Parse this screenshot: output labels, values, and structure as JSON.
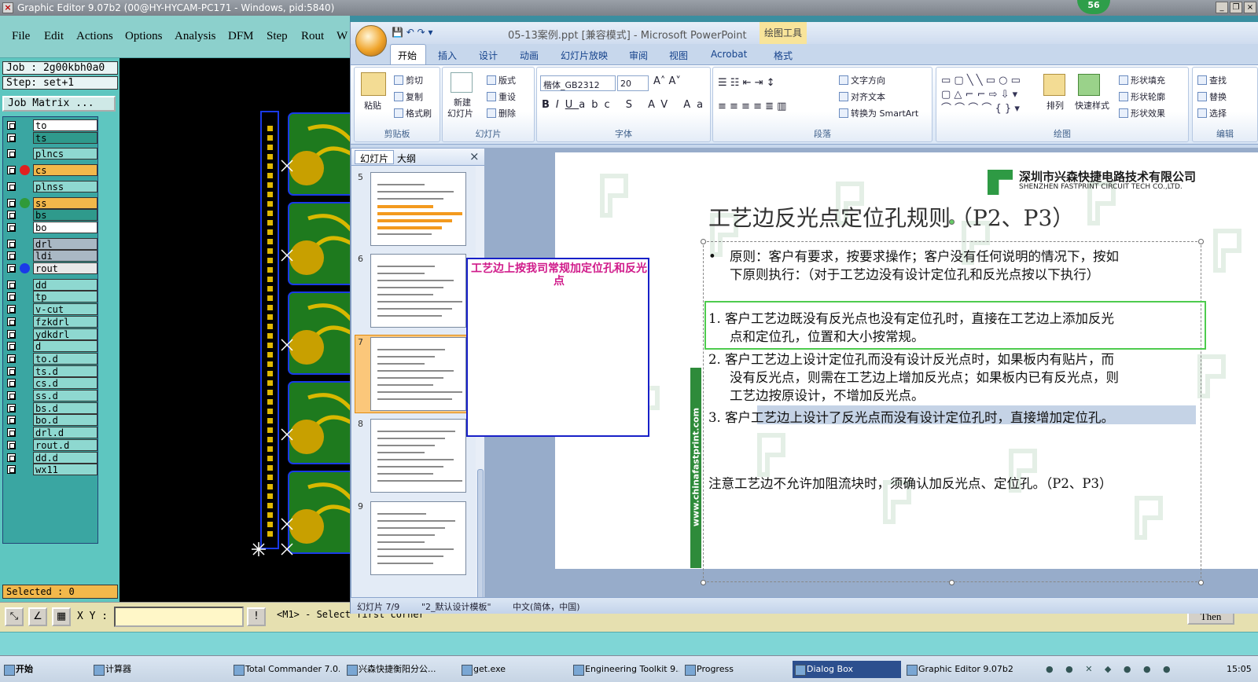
{
  "ge": {
    "title": "Graphic Editor 9.07b2 (00@HY-HYCAM-PC171 - Windows, pid:5840)",
    "menu": [
      "File",
      "Edit",
      "Actions",
      "Options",
      "Analysis",
      "DFM",
      "Step",
      "Rout",
      "W"
    ],
    "job": "Job : 2g00kbh0a0",
    "step": "Step: set+1",
    "job_matrix": "Job Matrix ...",
    "layers": [
      {
        "name": "to",
        "color": "#ffffff",
        "dot": ""
      },
      {
        "name": "ts",
        "color": "#2f9a8c",
        "dot": ""
      },
      {
        "name": "plncs",
        "color": "#8ed8d0",
        "dot": ""
      },
      {
        "name": "cs",
        "color": "#f2b84b",
        "dot": "#e02020"
      },
      {
        "name": "plnss",
        "color": "#8ed8d0",
        "dot": ""
      },
      {
        "name": "ss",
        "color": "#f2b84b",
        "dot": "#2f9a3a"
      },
      {
        "name": "bs",
        "color": "#2f9a8c",
        "dot": ""
      },
      {
        "name": "bo",
        "color": "#ffffff",
        "dot": ""
      },
      {
        "name": "drl",
        "color": "#a9b8c4",
        "dot": ""
      },
      {
        "name": "ldi",
        "color": "#a9b8c4",
        "dot": ""
      },
      {
        "name": "rout",
        "color": "#e8e8e8",
        "dot": "#1a3ae8"
      },
      {
        "name": "dd",
        "color": "#8ed8d0",
        "dot": ""
      },
      {
        "name": "tp",
        "color": "#8ed8d0",
        "dot": ""
      },
      {
        "name": "v-cut",
        "color": "#8ed8d0",
        "dot": ""
      },
      {
        "name": "fzkdrl",
        "color": "#8ed8d0",
        "dot": ""
      },
      {
        "name": "ydkdrl",
        "color": "#8ed8d0",
        "dot": ""
      },
      {
        "name": "d",
        "color": "#8ed8d0",
        "dot": ""
      },
      {
        "name": "to.d",
        "color": "#8ed8d0",
        "dot": ""
      },
      {
        "name": "ts.d",
        "color": "#8ed8d0",
        "dot": ""
      },
      {
        "name": "cs.d",
        "color": "#8ed8d0",
        "dot": ""
      },
      {
        "name": "ss.d",
        "color": "#8ed8d0",
        "dot": ""
      },
      {
        "name": "bs.d",
        "color": "#8ed8d0",
        "dot": ""
      },
      {
        "name": "bo.d",
        "color": "#8ed8d0",
        "dot": ""
      },
      {
        "name": "drl.d",
        "color": "#8ed8d0",
        "dot": ""
      },
      {
        "name": "rout.d",
        "color": "#8ed8d0",
        "dot": ""
      },
      {
        "name": "dd.d",
        "color": "#8ed8d0",
        "dot": ""
      },
      {
        "name": "wx11",
        "color": "#8ed8d0",
        "dot": ""
      }
    ],
    "selected": "Selected : 0",
    "xy_label": "X Y :",
    "xy_value": "",
    "status": "<M1> - Select first corner",
    "then_button": "Then",
    "badge": "56"
  },
  "ppt": {
    "title": "05-13案例.ppt [兼容模式] - Microsoft PowerPoint",
    "contextual_tab": "绘图工具",
    "tabs": [
      "开始",
      "插入",
      "设计",
      "动画",
      "幻灯片放映",
      "审阅",
      "视图",
      "Acrobat",
      "格式"
    ],
    "ribbon": {
      "clipboard": {
        "title": "剪贴板",
        "paste": "粘贴",
        "cut": "剪切",
        "copy": "复制",
        "format_painter": "格式刷"
      },
      "slides": {
        "title": "幻灯片",
        "new_slide": "新建",
        "new_slide2": "幻灯片",
        "layout": "版式",
        "reset": "重设",
        "delete": "删除"
      },
      "font": {
        "title": "字体",
        "font_name": "楷体_GB2312",
        "font_size": "20"
      },
      "paragraph": {
        "title": "段落",
        "text_direction": "文字方向",
        "align_text": "对齐文本",
        "smartart": "转换为 SmartArt"
      },
      "drawing": {
        "title": "绘图",
        "arrange": "排列",
        "quick_styles": "快速样式",
        "shape_fill": "形状填充",
        "shape_outline": "形状轮廓",
        "shape_effects": "形状效果"
      },
      "editing": {
        "title": "编辑",
        "find": "查找",
        "replace": "替换",
        "select": "选择"
      }
    },
    "pane_tabs": [
      "幻灯片",
      "大纲"
    ],
    "thumb_numbers": [
      "5",
      "6",
      "7",
      "8",
      "9"
    ],
    "callout": "工艺边上按我司常规加定位孔和反光点",
    "slide": {
      "company_cn": "深圳市兴森快捷电路技术有限公司",
      "company_en": "SHENZHEN FASTPRINT CIRCUIT TECH CO.,LTD.",
      "title": "工艺边反光点定位孔规则（P2、P3）",
      "bullet_mark": "•",
      "principle_1": "原则：客户有要求，按要求操作；客户没有任何说明的情况下，按如",
      "principle_2": "下原则执行：（对于工艺边没有设计定位孔和反光点按以下执行）",
      "item1_1": "1. 客户工艺边既没有反光点也没有定位孔时，直接在工艺边上添加反光",
      "item1_2": "点和定位孔，位置和大小按常规。",
      "item2_1": "2. 客户工艺边上设计定位孔而没有设计反光点时，如果板内有贴片，而",
      "item2_2": "没有反光点，则需在工艺边上增加反光点；如果板内已有反光点，则",
      "item2_3": "工艺边按原设计，不增加反光点。",
      "item3": "3. 客户工艺边上设计了反光点而没有设计定位孔时，直接增加定位孔。",
      "note": "注意工艺边不允许加阻流块时，须确认加反光点、定位孔。（P2、P3）",
      "side_text": "www.chinafastprint.com"
    },
    "status": {
      "slide_of": "幻灯片 7/9",
      "theme": "\"2_默认设计模板\"",
      "lang": "中文(简体，中国)"
    }
  },
  "taskbar": {
    "start": "开始",
    "items": [
      "计算器",
      "Total Commander 7.0...",
      "兴森快捷衡阳分公...",
      "get.exe",
      "Engineering Toolkit 9....",
      "Progress",
      "Dialog Box",
      "Graphic Editor 9.07b2..."
    ],
    "clock": "15:05"
  }
}
